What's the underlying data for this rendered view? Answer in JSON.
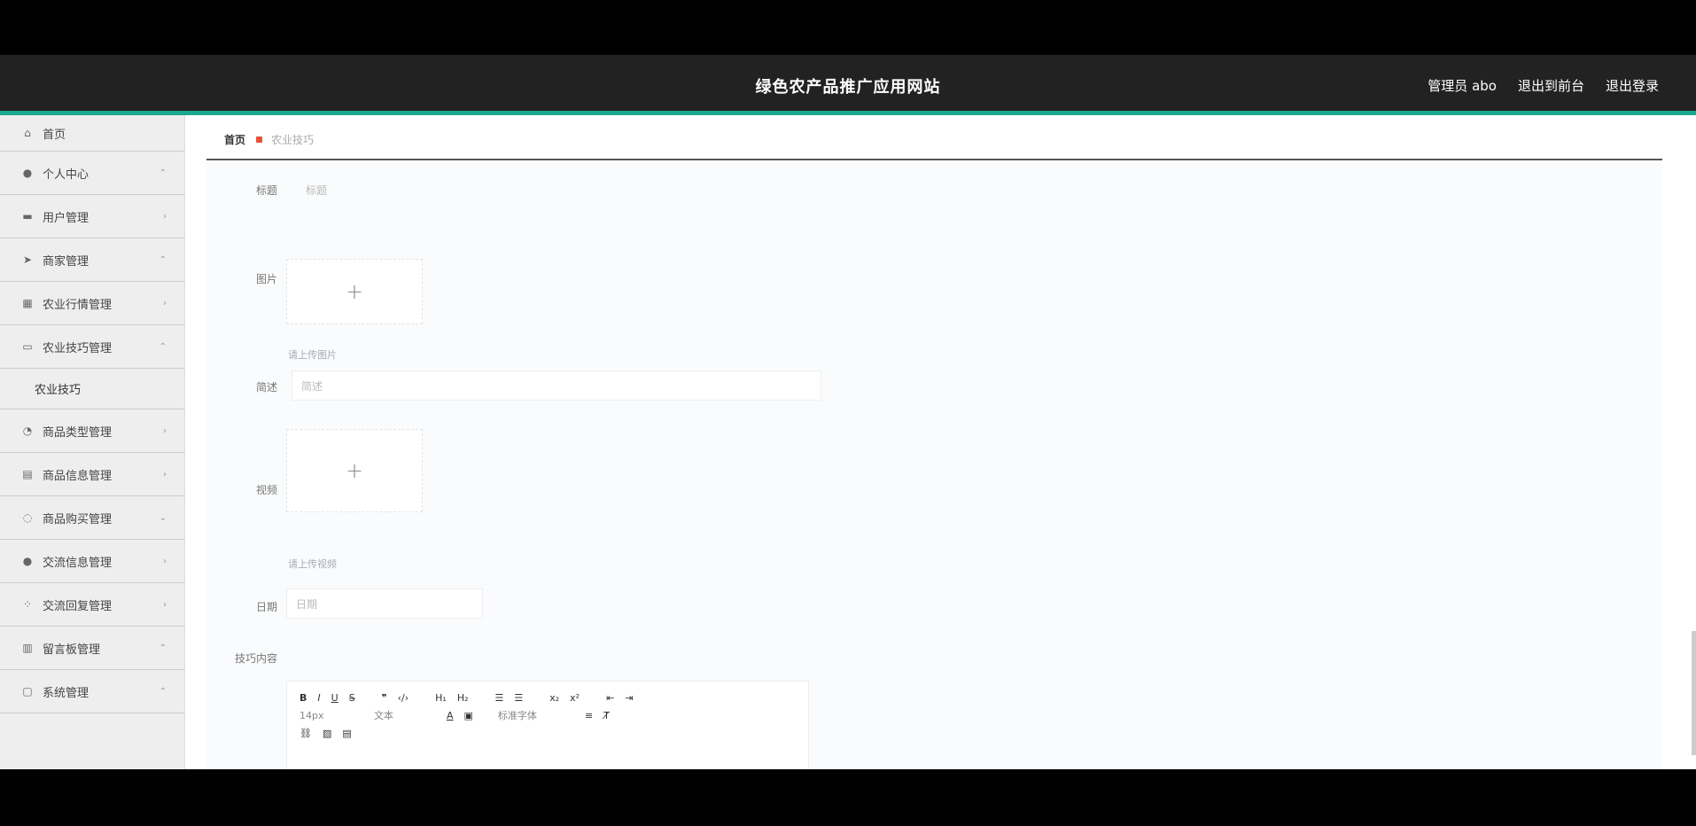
{
  "header": {
    "title": "绿色农产品推广应用网站",
    "admin_label": "管理员 abo",
    "to_front_label": "退出到前台",
    "logout_label": "退出登录"
  },
  "sidebar": {
    "items": [
      {
        "label": "首页",
        "icon": "home-icon",
        "chevron": ""
      },
      {
        "label": "个人中心",
        "icon": "user-icon",
        "chevron": "⌃"
      },
      {
        "label": "用户管理",
        "icon": "table-icon",
        "chevron": "›"
      },
      {
        "label": "商家管理",
        "icon": "send-icon",
        "chevron": "⌃"
      },
      {
        "label": "农业行情管理",
        "icon": "grid-icon",
        "chevron": "›"
      },
      {
        "label": "农业技巧管理",
        "icon": "monitor-icon",
        "chevron": "⌃"
      }
    ],
    "sub_item": "农业技巧",
    "items2": [
      {
        "label": "商品类型管理",
        "icon": "tag-icon",
        "chevron": "›"
      },
      {
        "label": "商品信息管理",
        "icon": "doc-icon",
        "chevron": "›"
      },
      {
        "label": "商品购买管理",
        "icon": "cart-icon",
        "chevron": "⌄"
      },
      {
        "label": "交流信息管理",
        "icon": "chat-icon",
        "chevron": "›"
      },
      {
        "label": "交流回复管理",
        "icon": "reply-icon",
        "chevron": "›"
      },
      {
        "label": "留言板管理",
        "icon": "chart-icon",
        "chevron": "⌃"
      },
      {
        "label": "系统管理",
        "icon": "settings-icon",
        "chevron": "⌃"
      }
    ]
  },
  "breadcrumb": {
    "home": "首页",
    "current": "农业技巧"
  },
  "form": {
    "title_label": "标题",
    "title_value": "标题",
    "image_label": "图片",
    "image_hint": "请上传图片",
    "summary_label": "简述",
    "summary_placeholder": "简述",
    "video_label": "视频",
    "video_hint": "请上传视频",
    "date_label": "日期",
    "date_placeholder": "日期",
    "content_label": "技巧内容"
  },
  "editor": {
    "font_size": "14px",
    "text_type": "文本",
    "font_family": "标准字体"
  }
}
